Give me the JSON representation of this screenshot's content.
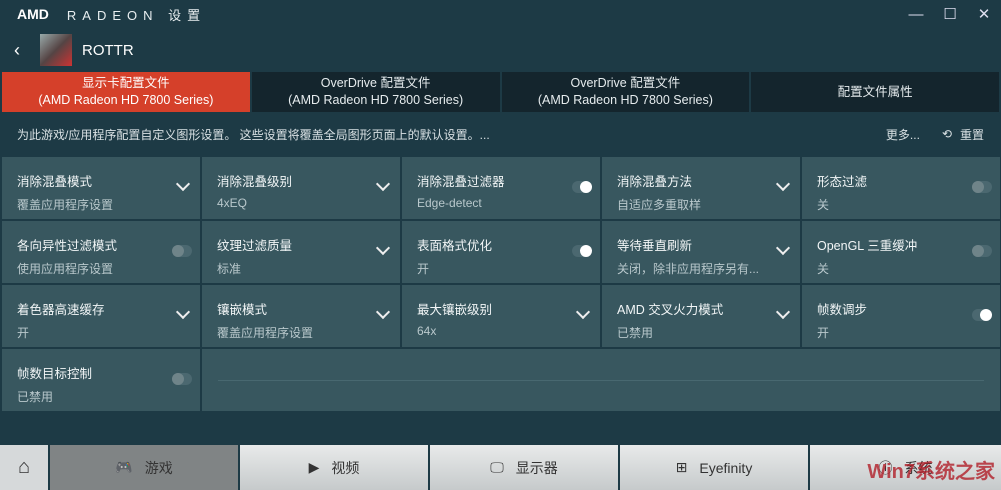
{
  "title": {
    "logo": "AMD",
    "brand": "RADEON 设置",
    "minimize": "—",
    "maximize": "☐",
    "close": "✕"
  },
  "header": {
    "back": "‹",
    "game": "ROTTR"
  },
  "tabs": [
    {
      "line1": "显示卡配置文件",
      "line2": "(AMD Radeon HD 7800 Series)"
    },
    {
      "line1": "OverDrive 配置文件",
      "line2": "(AMD Radeon HD 7800 Series)"
    },
    {
      "line1": "OverDrive 配置文件",
      "line2": "(AMD Radeon HD 7800 Series)"
    },
    {
      "line1": "配置文件属性",
      "line2": ""
    }
  ],
  "description": {
    "text": "为此游戏/应用程序配置自定义图形设置。 这些设置将覆盖全局图形页面上的默认设置。...",
    "more": "更多...",
    "reset": "重置"
  },
  "settings": [
    {
      "title": "消除混叠模式",
      "value": "覆盖应用程序设置",
      "control": "dropdown"
    },
    {
      "title": "消除混叠级别",
      "value": "4xEQ",
      "control": "dropdown"
    },
    {
      "title": "消除混叠过滤器",
      "value": "Edge-detect",
      "control": "toggle-on"
    },
    {
      "title": "消除混叠方法",
      "value": "自适应多重取样",
      "control": "dropdown"
    },
    {
      "title": "形态过滤",
      "value": "关",
      "control": "toggle-off"
    },
    {
      "title": "各向异性过滤模式",
      "value": "使用应用程序设置",
      "control": "toggle-off"
    },
    {
      "title": "纹理过滤质量",
      "value": "标准",
      "control": "dropdown"
    },
    {
      "title": "表面格式优化",
      "value": "开",
      "control": "toggle-on"
    },
    {
      "title": "等待垂直刷新",
      "value": "关闭，除非应用程序另有...",
      "control": "dropdown"
    },
    {
      "title": "OpenGL 三重缓冲",
      "value": "关",
      "control": "toggle-off"
    },
    {
      "title": "着色器高速缓存",
      "value": "开",
      "control": "dropdown"
    },
    {
      "title": "镶嵌模式",
      "value": "覆盖应用程序设置",
      "control": "dropdown"
    },
    {
      "title": "最大镶嵌级别",
      "value": "64x",
      "control": "dropdown"
    },
    {
      "title": "AMD 交叉火力模式",
      "value": "已禁用",
      "control": "dropdown"
    },
    {
      "title": "帧数调步",
      "value": "开",
      "control": "toggle-on"
    },
    {
      "title": "帧数目标控制",
      "value": "已禁用",
      "control": "toggle-off"
    }
  ],
  "nav": [
    {
      "label": "游戏",
      "icon": "🎮"
    },
    {
      "label": "视频",
      "icon": "▶"
    },
    {
      "label": "显示器",
      "icon": "🖵"
    },
    {
      "label": "Eyefinity",
      "icon": "⊞"
    },
    {
      "label": "系统",
      "icon": "ⓘ"
    }
  ],
  "watermark": "Win7系统之家",
  "colors": {
    "accent": "#d5402a",
    "background": "#1d3a45",
    "cell": "#38575f"
  }
}
